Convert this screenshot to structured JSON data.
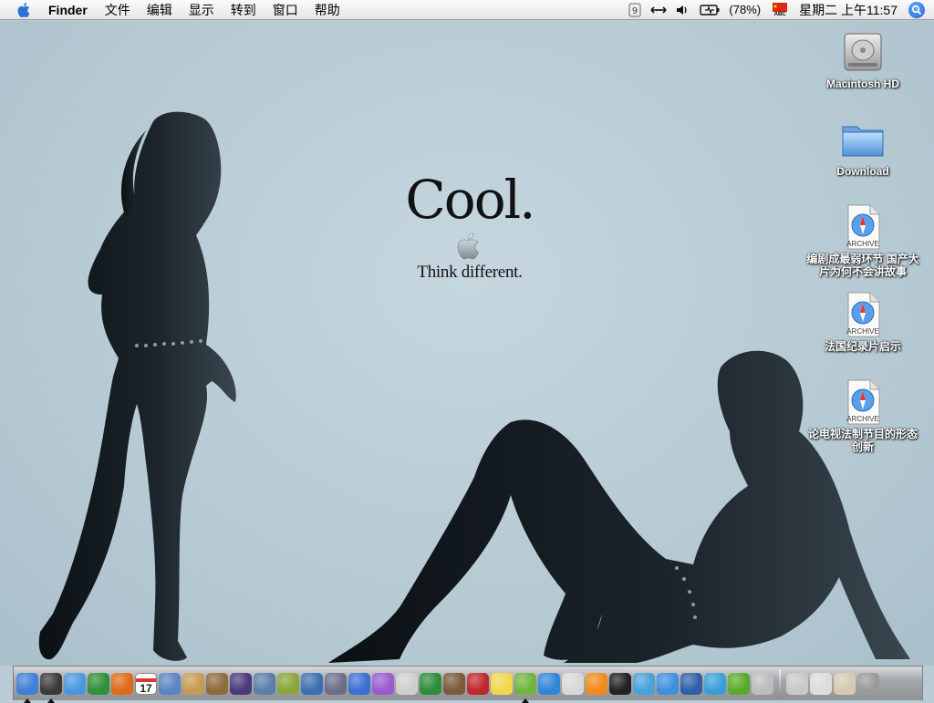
{
  "menubar": {
    "app_name": "Finder",
    "items": [
      "文件",
      "编辑",
      "显示",
      "转到",
      "窗口",
      "帮助"
    ],
    "status": {
      "battery_percent": "(78%)",
      "input_flag_label": "ABC",
      "clock": "星期二 上午11:57"
    }
  },
  "wallpaper": {
    "headline": "Cool.",
    "tagline": "Think different."
  },
  "desktop_icons": [
    {
      "label": "Macintosh HD",
      "icon": "hard-drive-icon"
    },
    {
      "label": "Download",
      "icon": "folder-icon"
    },
    {
      "label": "编剧成最弱环节 国产大片为何不会讲故事",
      "icon": "safari-archive-icon",
      "badge": "ARCHIVE"
    },
    {
      "label": "法国纪录片启示",
      "icon": "safari-archive-icon",
      "badge": "ARCHIVE"
    },
    {
      "label": "论电视法制节目的形态创新",
      "icon": "safari-archive-icon",
      "badge": "ARCHIVE"
    }
  ],
  "dock": {
    "calendar_day": "17",
    "apps": [
      {
        "name": "finder-icon",
        "color": "#3f7fd6",
        "running": true
      },
      {
        "name": "dashboard-icon",
        "color": "#3a3a3a",
        "running": true
      },
      {
        "name": "safari-icon",
        "color": "#4a97e0",
        "running": false
      },
      {
        "name": "internet-explorer-icon",
        "color": "#2f8f3a",
        "running": false
      },
      {
        "name": "firefox-icon",
        "color": "#e06a1b",
        "running": false
      },
      {
        "name": "ical-icon",
        "color": "#eeeeee",
        "running": false
      },
      {
        "name": "preview-icon",
        "color": "#5c84c4",
        "running": false
      },
      {
        "name": "address-book-icon",
        "color": "#c79a55",
        "running": false
      },
      {
        "name": "iphoto-icon",
        "color": "#8c6a3a",
        "running": false
      },
      {
        "name": "itunes-vis-icon",
        "color": "#4a3a7a",
        "running": false
      },
      {
        "name": "photo-browser-icon",
        "color": "#5a7fa8",
        "running": false
      },
      {
        "name": "pencil-icon",
        "color": "#8aa53a",
        "running": false
      },
      {
        "name": "keynote-icon",
        "color": "#3d6fb0",
        "running": false
      },
      {
        "name": "script-editor-icon",
        "color": "#6d6d8a",
        "running": false
      },
      {
        "name": "word-icon",
        "color": "#3b6fd4",
        "running": false
      },
      {
        "name": "powerpoint-icon",
        "color": "#9a5bd0",
        "running": false
      },
      {
        "name": "textedit-icon",
        "color": "#cfcfcf",
        "running": false
      },
      {
        "name": "excel-icon",
        "color": "#2e8b3a",
        "running": false
      },
      {
        "name": "dictionary-icon",
        "color": "#7a5a3a",
        "running": false
      },
      {
        "name": "acrobat-icon",
        "color": "#c0282c",
        "running": false
      },
      {
        "name": "stickies-icon",
        "color": "#f2d64b",
        "running": false
      },
      {
        "name": "itunes-icon",
        "color": "#6fb43f",
        "running": true
      },
      {
        "name": "quicktime-icon",
        "color": "#2f86d6",
        "running": false
      },
      {
        "name": "mplayer-icon",
        "color": "#d8d8d8",
        "running": false
      },
      {
        "name": "vlc-icon",
        "color": "#f08a1c",
        "running": false
      },
      {
        "name": "qq-icon",
        "color": "#222222",
        "running": false
      },
      {
        "name": "network-icon",
        "color": "#4aa0d8",
        "running": false
      },
      {
        "name": "messenger-icon",
        "color": "#3f8ee0",
        "running": false
      },
      {
        "name": "plane-icon",
        "color": "#2f5fa8",
        "running": false
      },
      {
        "name": "forward-icon",
        "color": "#39a0d6",
        "running": false
      },
      {
        "name": "utility-icon",
        "color": "#5aaa2a",
        "running": false
      },
      {
        "name": "system-preferences-icon",
        "color": "#bdbdbd",
        "running": false
      }
    ],
    "stacks": [
      {
        "name": "applications-stack-icon",
        "color": "#c9c9c9"
      },
      {
        "name": "documents-stack-icon",
        "color": "#dcdcdc"
      },
      {
        "name": "downloads-stack-icon",
        "color": "#d7c9b0"
      },
      {
        "name": "trash-icon",
        "color": "#9a9a9a"
      }
    ]
  }
}
